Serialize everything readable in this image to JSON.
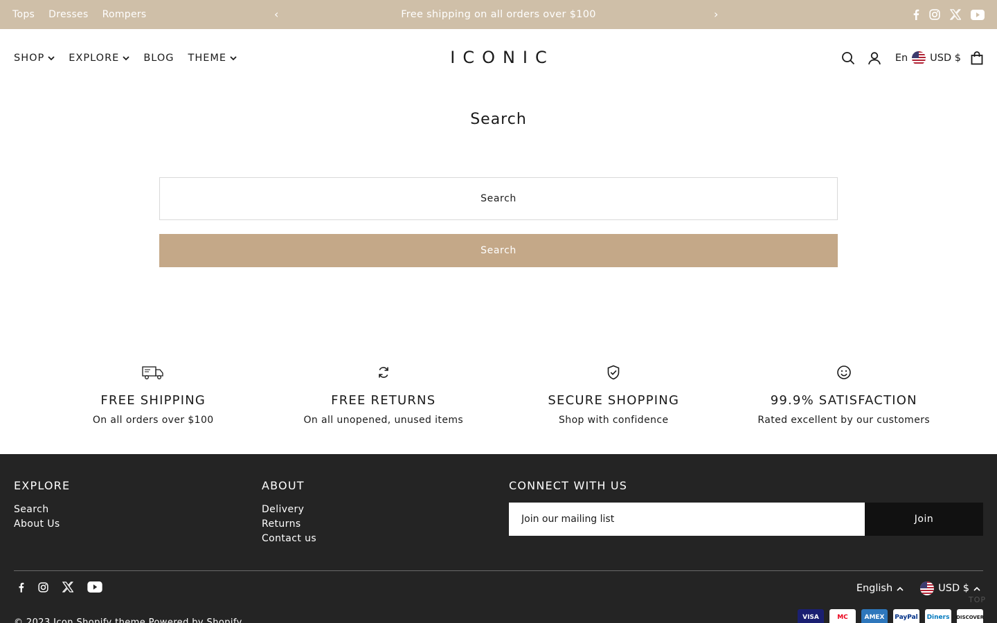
{
  "topbar": {
    "links": [
      "Tops",
      "Dresses",
      "Rompers"
    ],
    "announcement": "Free shipping on all orders over $100",
    "prev_arrow": "‹",
    "next_arrow": "›",
    "socials": [
      "facebook-icon",
      "instagram-icon",
      "x-icon",
      "youtube-icon"
    ]
  },
  "header": {
    "nav": [
      {
        "label": "SHOP",
        "has_dropdown": true
      },
      {
        "label": "EXPLORE",
        "has_dropdown": true
      },
      {
        "label": "BLOG",
        "has_dropdown": false
      },
      {
        "label": "THEME",
        "has_dropdown": true
      }
    ],
    "logo": "ICONIC",
    "language": "En",
    "currency": "USD $"
  },
  "main": {
    "title": "Search",
    "search_placeholder": "Search",
    "search_button": "Search"
  },
  "features": [
    {
      "icon": "truck-icon",
      "title": "FREE SHIPPING",
      "text": "On all orders over $100"
    },
    {
      "icon": "refresh-icon",
      "title": "FREE RETURNS",
      "text": "On all unopened, unused items"
    },
    {
      "icon": "shield-check-icon",
      "title": "SECURE SHOPPING",
      "text": "Shop with confidence"
    },
    {
      "icon": "smiley-icon",
      "title": "99.9% SATISFACTION",
      "text": "Rated excellent by our customers"
    }
  ],
  "footer": {
    "explore": {
      "heading": "EXPLORE",
      "links": [
        "Search",
        "About Us"
      ]
    },
    "about": {
      "heading": "ABOUT",
      "links": [
        "Delivery",
        "Returns",
        "Contact us"
      ]
    },
    "connect": {
      "heading": "CONNECT WITH US",
      "placeholder": "Join our mailing list",
      "button": "Join"
    },
    "language": "English",
    "currency": "USD $",
    "to_top": "TOP",
    "copyright": "© 2023 Icon Shopify theme   Powered by Shopify",
    "payments": [
      "VISA",
      "MC",
      "AMEX",
      "PayPal",
      "Diners",
      "DISCOVER"
    ]
  },
  "colors": {
    "topbar_bg": "#cfbfa8",
    "accent": "#c4a888",
    "footer_bg": "#242424"
  }
}
